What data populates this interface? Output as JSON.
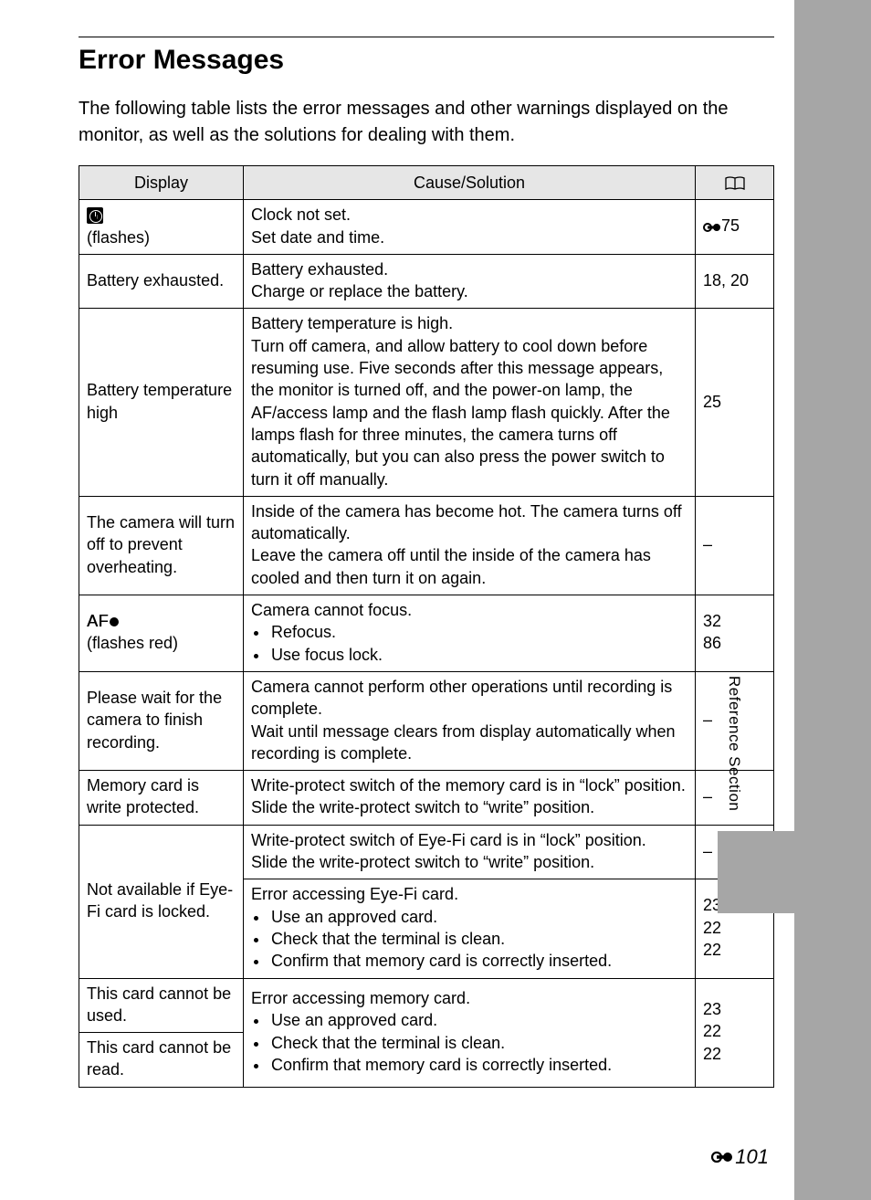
{
  "title": "Error Messages",
  "intro": "The following table lists the error messages and other warnings displayed on the monitor, as well as the solutions for dealing with them.",
  "headers": {
    "display": "Display",
    "cause": "Cause/Solution",
    "ref": ""
  },
  "side_label": "Reference Section",
  "page_number": "101",
  "rows": {
    "r1": {
      "display_sub": "(flashes)",
      "cause_a": "Clock not set.",
      "cause_b": "Set date and time.",
      "ref": "75"
    },
    "r2": {
      "display": "Battery exhausted.",
      "cause_a": "Battery exhausted.",
      "cause_b": "Charge or replace the battery.",
      "ref": "18, 20"
    },
    "r3": {
      "display": "Battery temperature high",
      "cause_a": "Battery temperature is high.",
      "cause_b": "Turn off camera, and allow battery to cool down before resuming use. Five seconds after this message appears, the monitor is turned off, and the power-on lamp, the AF/access lamp and the flash lamp flash quickly. After the lamps flash for three minutes, the camera turns off automatically, but you can also press the power switch to turn it off manually.",
      "ref": "25"
    },
    "r4": {
      "display": "The camera will turn off to prevent overheating.",
      "cause_a": "Inside of the camera has become hot. The camera turns off automatically.",
      "cause_b": "Leave the camera off until the inside of the camera has cooled and then turn it on again.",
      "ref": "–"
    },
    "r5": {
      "display_sub": "(flashes red)",
      "cause_a": "Camera cannot focus.",
      "b1": "Refocus.",
      "b2": "Use focus lock.",
      "ref_a": "32",
      "ref_b": "86"
    },
    "r6": {
      "display": "Please wait for the camera to finish recording.",
      "cause_a": "Camera cannot perform other operations until recording is complete.",
      "cause_b": "Wait until message clears from display automatically when recording is complete.",
      "ref": "–"
    },
    "r7": {
      "display": "Memory card is write protected.",
      "cause_a": "Write-protect switch of the memory card is in “lock” position.",
      "cause_b": "Slide the write-protect switch to “write” position.",
      "ref": "–"
    },
    "r8": {
      "display": "Not available if Eye-Fi card is locked.",
      "top_a": "Write-protect switch of Eye-Fi card is in “lock” position.",
      "top_b": "Slide the write-protect switch to “write” position.",
      "top_ref": "–",
      "bot_a": "Error accessing Eye-Fi card.",
      "b1": "Use an approved card.",
      "b2": "Check that the terminal is clean.",
      "b3": "Confirm that memory card is correctly inserted.",
      "ref1": "23",
      "ref2": "22",
      "ref3": "22"
    },
    "r9": {
      "display_a": "This card cannot be used.",
      "display_b": "This card cannot be read.",
      "cause_a": "Error accessing memory card.",
      "b1": "Use an approved card.",
      "b2": "Check that the terminal is clean.",
      "b3": "Confirm that memory card is correctly inserted.",
      "ref1": "23",
      "ref2": "22",
      "ref3": "22"
    }
  }
}
